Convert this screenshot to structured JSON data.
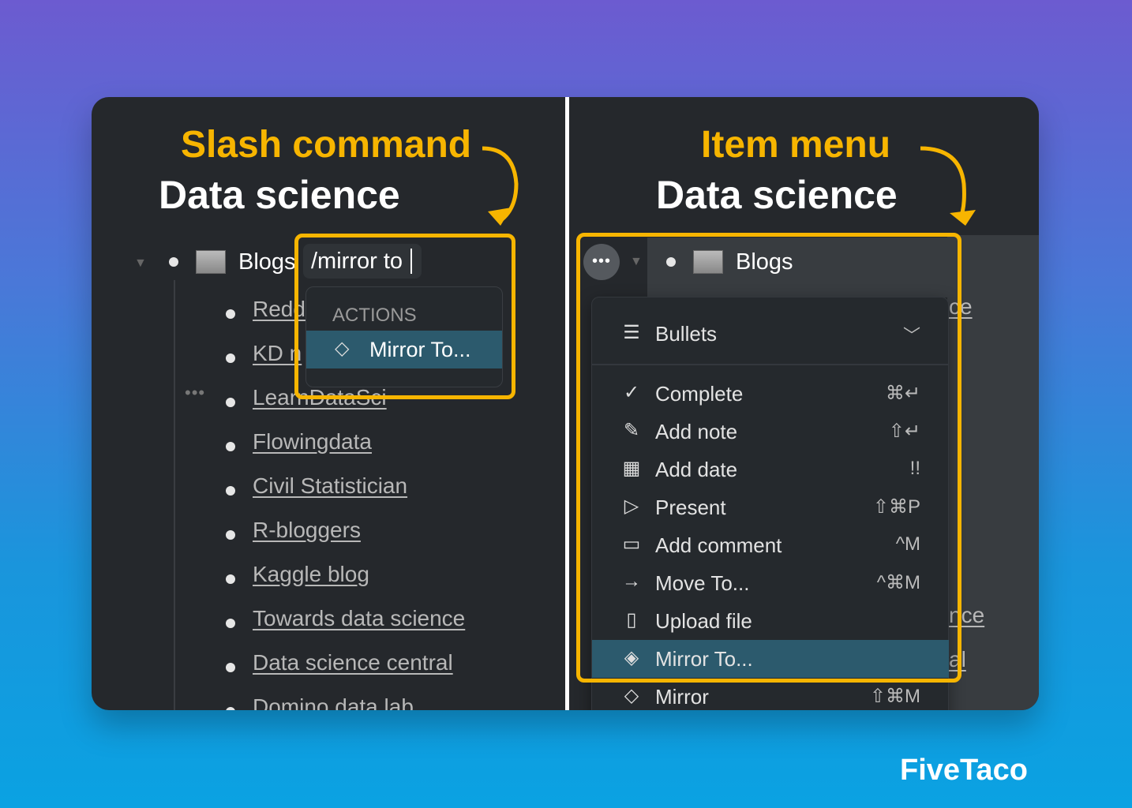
{
  "left": {
    "annotation": "Slash command",
    "title": "Data science",
    "parent": "Blogs",
    "input_value": "/mirror to",
    "popup": {
      "section": "ACTIONS",
      "item": "Mirror To..."
    },
    "items": [
      "Redd",
      "KD n",
      "LearnDataSci",
      "Flowingdata",
      "Civil Statistician",
      "R-bloggers",
      "Kaggle blog",
      "Towards data science",
      "Data science central",
      "Domino data lab"
    ]
  },
  "right": {
    "annotation": "Item menu",
    "title": "Data science",
    "parent": "Blogs",
    "menu": {
      "layout": "Bullets",
      "items": [
        {
          "label": "Complete",
          "shortcut": "⌘↵",
          "icon": "check-icon"
        },
        {
          "label": "Add note",
          "shortcut": "⇧↵",
          "icon": "pencil-icon"
        },
        {
          "label": "Add date",
          "shortcut": "!!",
          "icon": "calendar-icon"
        },
        {
          "label": "Present",
          "shortcut": "⇧⌘P",
          "icon": "play-icon"
        },
        {
          "label": "Add comment",
          "shortcut": "^M",
          "icon": "comment-icon"
        },
        {
          "label": "Move To...",
          "shortcut": "^⌘M",
          "icon": "arrow-right-icon"
        },
        {
          "label": "Upload file",
          "shortcut": "",
          "icon": "file-icon"
        },
        {
          "label": "Mirror To...",
          "shortcut": "",
          "icon": "mirror-to-icon",
          "selected": true
        },
        {
          "label": "Mirror",
          "shortcut": "⇧⌘M",
          "icon": "diamond-icon"
        }
      ]
    },
    "behind": [
      "ce",
      "nce",
      "al"
    ]
  },
  "brand": "FiveTaco",
  "colors": {
    "highlight": "#f7b500",
    "selected": "#2c5a6d",
    "card": "#25282c"
  }
}
